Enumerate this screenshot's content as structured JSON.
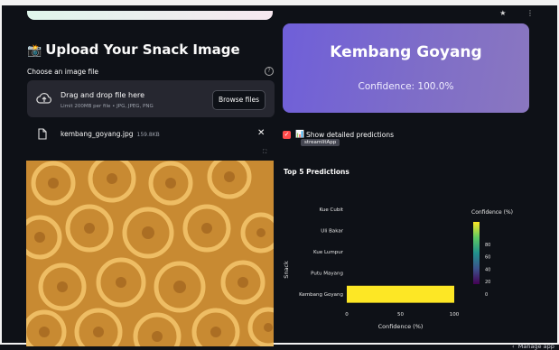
{
  "upload": {
    "heading": "Upload Your Snack Image",
    "heading_icon": "camera-emoji",
    "choose_label": "Choose an image file",
    "dropzone_title": "Drag and drop file here",
    "dropzone_limit": "Limit 200MB per file • JPG, JPEG, PNG",
    "browse_label": "Browse files"
  },
  "file": {
    "name": "kembang_goyang.jpg",
    "size": "159.8KB"
  },
  "prediction": {
    "label": "Kembang Goyang",
    "confidence": "Confidence: 100.0%"
  },
  "detail": {
    "checkbox_label": "Show detailed predictions",
    "checked": true,
    "tooltip": "streamlitApp"
  },
  "top5": {
    "title": "Top 5 Predictions"
  },
  "chart_data": {
    "type": "bar",
    "orientation": "horizontal",
    "categories": [
      "Kue Cubit",
      "Uli Bakar",
      "Kue Lumpur",
      "Putu Mayang",
      "Kembang Goyang"
    ],
    "values": [
      0,
      0,
      0,
      0,
      100
    ],
    "xlabel": "Confidence (%)",
    "ylabel": "Snack",
    "xlim": [
      0,
      100
    ],
    "xticks": [
      0,
      50,
      100
    ],
    "bar_color": "#fde725",
    "colorbar": {
      "label": "Confidence (%)",
      "ticks": [
        0,
        20,
        40,
        60,
        80
      ]
    },
    "grid": false
  },
  "footer": {
    "manage_app": "Manage app"
  }
}
